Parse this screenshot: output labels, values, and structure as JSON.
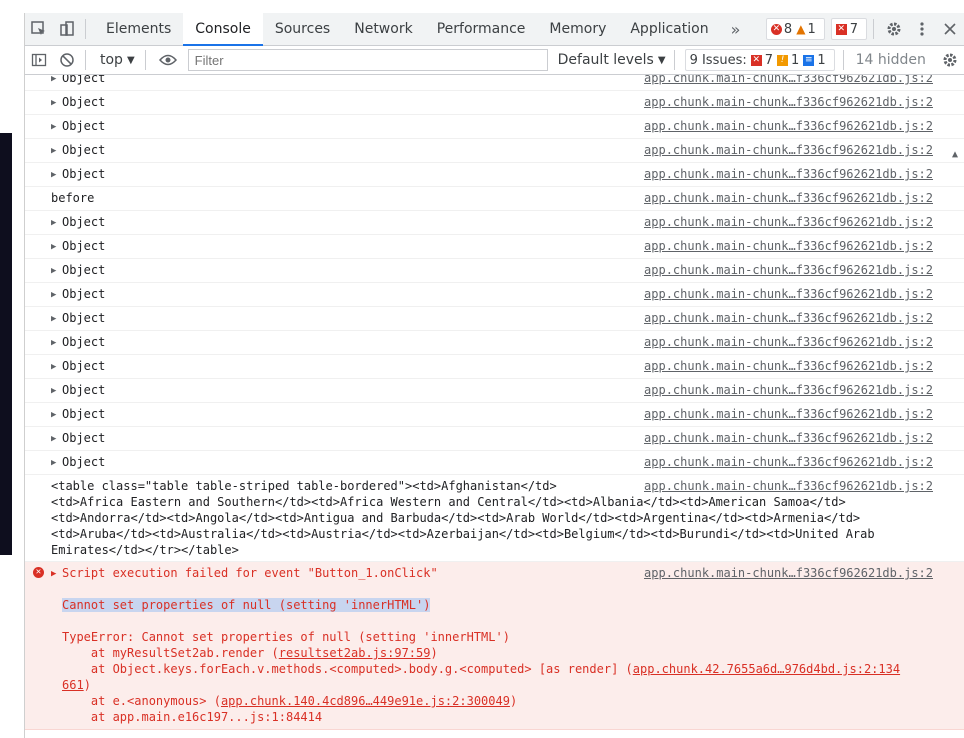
{
  "tabs": [
    "Elements",
    "Console",
    "Sources",
    "Network",
    "Performance",
    "Memory",
    "Application"
  ],
  "active_tab": "Console",
  "tab_overflow": "»",
  "badges": {
    "errors": "8",
    "warnings": "1",
    "issues": "7"
  },
  "toolbar": {
    "context": "top",
    "filter_placeholder": "Filter",
    "levels": "Default levels",
    "issues_label": "9 Issues:",
    "issues_errors": "7",
    "issues_warnings": "1",
    "issues_info": "1",
    "hidden": "14 hidden"
  },
  "source_link": "app.chunk.main-chunk…f336cf962621db.js:2",
  "messages": [
    {
      "text": "Object"
    },
    {
      "text": "Object"
    },
    {
      "text": "Object"
    },
    {
      "text": "Object"
    },
    {
      "text": "Object"
    },
    {
      "text": "before",
      "plain": true
    },
    {
      "text": "Object"
    },
    {
      "text": "Object"
    },
    {
      "text": "Object"
    },
    {
      "text": "Object"
    },
    {
      "text": "Object"
    },
    {
      "text": "Object"
    },
    {
      "text": "Object"
    },
    {
      "text": "Object"
    },
    {
      "text": "Object"
    },
    {
      "text": "Object"
    },
    {
      "text": "Object"
    }
  ],
  "table_message": "<table class=\"table table-striped table-bordered\"><td>Afghanistan</td>\n<td>Africa Eastern and Southern</td><td>Africa Western and Central</td><td>Albania</td><td>American Samoa</td>\n<td>Andorra</td><td>Angola</td><td>Antigua and Barbuda</td><td>Arab World</td><td>Argentina</td><td>Armenia</td>\n<td>Aruba</td><td>Australia</td><td>Austria</td><td>Azerbaijan</td><td>Belgium</td><td>Burundi</td><td>United Arab\nEmirates</td></tr></table>",
  "error": {
    "title": "Script execution failed for event \"Button_1.onClick\"",
    "selected": "Cannot set properties of null (setting 'innerHTML')",
    "type_line": "TypeError: Cannot set properties of null (setting 'innerHTML')",
    "stack1_prefix": "    at myResultSet2ab.render (",
    "stack1_link": "resultset2ab.js:97:59",
    "stack2_prefix": "    at Object.keys.forEach.v.methods.<computed>.body.g.<computed> [as render] (",
    "stack2_link_a": "app.chunk.42.7655a6d…976d4bd.js:2:134",
    "stack2_link_b": "661",
    "stack3_prefix": "    at e.<anonymous> (",
    "stack3_link": "app.chunk.140.4cd896…449e91e.js:2:300049",
    "stack4": "    at app.main.e16c197...js:1:84414"
  }
}
